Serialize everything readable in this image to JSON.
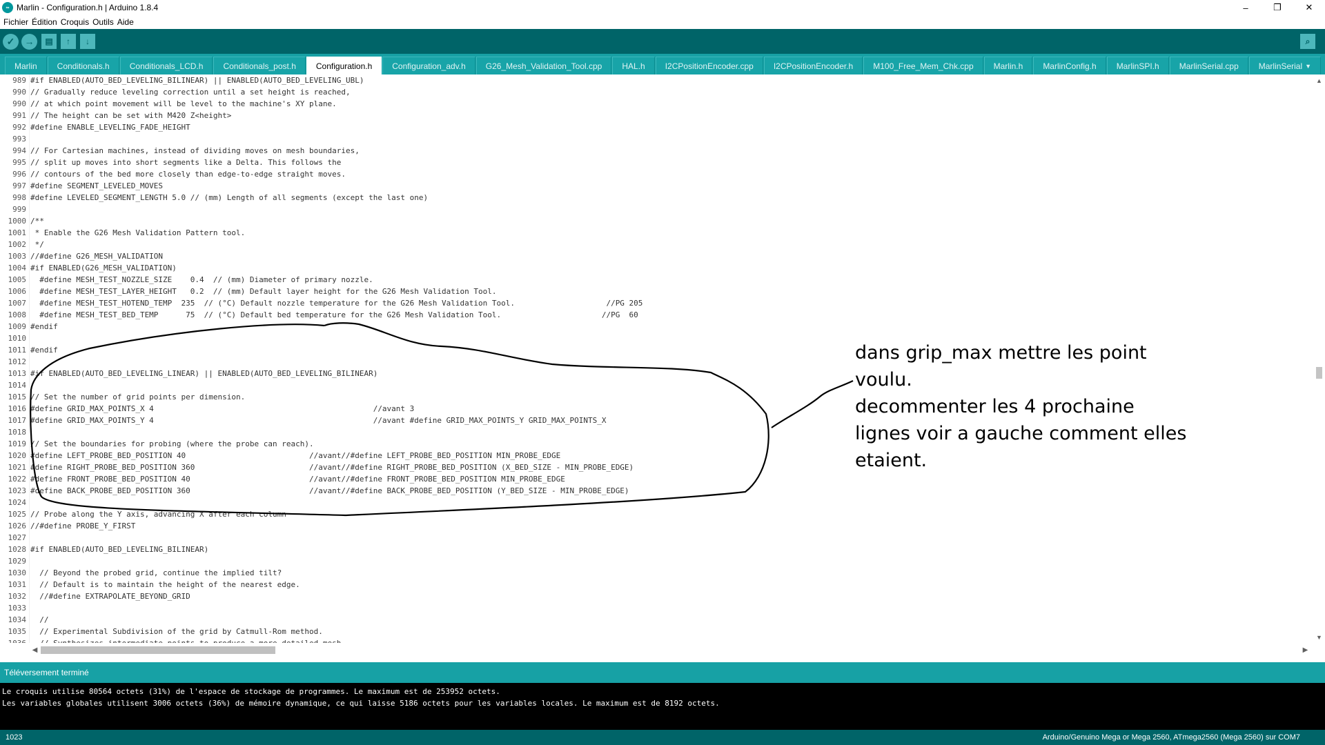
{
  "window": {
    "title": "Marlin - Configuration.h | Arduino 1.8.4",
    "app_icon_text": "∞",
    "controls": {
      "minimize": "–",
      "maximize": "❐",
      "close": "✕"
    }
  },
  "menu": [
    "Fichier",
    "Édition",
    "Croquis",
    "Outils",
    "Aide"
  ],
  "toolbar": {
    "verify_icon": "✓",
    "upload_icon": "→",
    "new_icon": "▤",
    "open_icon": "↑",
    "save_icon": "↓",
    "serial_monitor_icon": "⌕"
  },
  "tabs": [
    {
      "label": "Marlin"
    },
    {
      "label": "Conditionals.h"
    },
    {
      "label": "Conditionals_LCD.h"
    },
    {
      "label": "Conditionals_post.h"
    },
    {
      "label": "Configuration.h",
      "active": true
    },
    {
      "label": "Configuration_adv.h"
    },
    {
      "label": "G26_Mesh_Validation_Tool.cpp"
    },
    {
      "label": "HAL.h"
    },
    {
      "label": "I2CPositionEncoder.cpp"
    },
    {
      "label": "I2CPositionEncoder.h"
    },
    {
      "label": "M100_Free_Mem_Chk.cpp"
    },
    {
      "label": "Marlin.h"
    },
    {
      "label": "MarlinConfig.h"
    },
    {
      "label": "MarlinSPI.h"
    },
    {
      "label": "MarlinSerial.cpp"
    },
    {
      "label": "MarlinSerial",
      "dropdown": true
    }
  ],
  "code_lines": [
    {
      "n": "989",
      "t": "#if ENABLED(AUTO_BED_LEVELING_BILINEAR) || ENABLED(AUTO_BED_LEVELING_UBL)"
    },
    {
      "n": "990",
      "t": "// Gradually reduce leveling correction until a set height is reached,"
    },
    {
      "n": "990",
      "t": "// at which point movement will be level to the machine's XY plane."
    },
    {
      "n": "991",
      "t": "// The height can be set with M420 Z<height>"
    },
    {
      "n": "992",
      "t": "#define ENABLE_LEVELING_FADE_HEIGHT"
    },
    {
      "n": "993",
      "t": ""
    },
    {
      "n": "994",
      "t": "// For Cartesian machines, instead of dividing moves on mesh boundaries,"
    },
    {
      "n": "995",
      "t": "// split up moves into short segments like a Delta. This follows the"
    },
    {
      "n": "996",
      "t": "// contours of the bed more closely than edge-to-edge straight moves."
    },
    {
      "n": "997",
      "t": "#define SEGMENT_LEVELED_MOVES"
    },
    {
      "n": "998",
      "t": "#define LEVELED_SEGMENT_LENGTH 5.0 // (mm) Length of all segments (except the last one)"
    },
    {
      "n": "999",
      "t": ""
    },
    {
      "n": "1000",
      "t": "/**"
    },
    {
      "n": "1001",
      "t": " * Enable the G26 Mesh Validation Pattern tool."
    },
    {
      "n": "1002",
      "t": " */"
    },
    {
      "n": "1003",
      "t": "//#define G26_MESH_VALIDATION"
    },
    {
      "n": "1004",
      "t": "#if ENABLED(G26_MESH_VALIDATION)"
    },
    {
      "n": "1005",
      "t": "  #define MESH_TEST_NOZZLE_SIZE    0.4  // (mm) Diameter of primary nozzle."
    },
    {
      "n": "1006",
      "t": "  #define MESH_TEST_LAYER_HEIGHT   0.2  // (mm) Default layer height for the G26 Mesh Validation Tool."
    },
    {
      "n": "1007",
      "t": "  #define MESH_TEST_HOTEND_TEMP  235  // (°C) Default nozzle temperature for the G26 Mesh Validation Tool.                    //PG 205"
    },
    {
      "n": "1008",
      "t": "  #define MESH_TEST_BED_TEMP      75  // (°C) Default bed temperature for the G26 Mesh Validation Tool.                      //PG  60"
    },
    {
      "n": "1009",
      "t": "#endif"
    },
    {
      "n": "1010",
      "t": ""
    },
    {
      "n": "1011",
      "t": "#endif"
    },
    {
      "n": "1012",
      "t": ""
    },
    {
      "n": "1013",
      "t": "#if ENABLED(AUTO_BED_LEVELING_LINEAR) || ENABLED(AUTO_BED_LEVELING_BILINEAR)"
    },
    {
      "n": "1014",
      "t": ""
    },
    {
      "n": "1015",
      "t": "// Set the number of grid points per dimension."
    },
    {
      "n": "1016",
      "t": "#define GRID_MAX_POINTS_X 4                                                //avant 3"
    },
    {
      "n": "1017",
      "t": "#define GRID_MAX_POINTS_Y 4                                                //avant #define GRID_MAX_POINTS_Y GRID_MAX_POINTS_X"
    },
    {
      "n": "1018",
      "t": ""
    },
    {
      "n": "1019",
      "t": "// Set the boundaries for probing (where the probe can reach)."
    },
    {
      "n": "1020",
      "t": "#define LEFT_PROBE_BED_POSITION 40                           //avant//#define LEFT_PROBE_BED_POSITION MIN_PROBE_EDGE"
    },
    {
      "n": "1021",
      "t": "#define RIGHT_PROBE_BED_POSITION 360                         //avant//#define RIGHT_PROBE_BED_POSITION (X_BED_SIZE - MIN_PROBE_EDGE)"
    },
    {
      "n": "1022",
      "t": "#define FRONT_PROBE_BED_POSITION 40                          //avant//#define FRONT_PROBE_BED_POSITION MIN_PROBE_EDGE"
    },
    {
      "n": "1023",
      "t": "#define BACK_PROBE_BED_POSITION 360                          //avant//#define BACK_PROBE_BED_POSITION (Y_BED_SIZE - MIN_PROBE_EDGE)"
    },
    {
      "n": "1024",
      "t": ""
    },
    {
      "n": "1025",
      "t": "// Probe along the Y axis, advancing X after each column"
    },
    {
      "n": "1026",
      "t": "//#define PROBE_Y_FIRST"
    },
    {
      "n": "1027",
      "t": ""
    },
    {
      "n": "1028",
      "t": "#if ENABLED(AUTO_BED_LEVELING_BILINEAR)"
    },
    {
      "n": "1029",
      "t": ""
    },
    {
      "n": "1030",
      "t": "  // Beyond the probed grid, continue the implied tilt?"
    },
    {
      "n": "1031",
      "t": "  // Default is to maintain the height of the nearest edge."
    },
    {
      "n": "1032",
      "t": "  //#define EXTRAPOLATE_BEYOND_GRID"
    },
    {
      "n": "1033",
      "t": ""
    },
    {
      "n": "1034",
      "t": "  //"
    },
    {
      "n": "1035",
      "t": "  // Experimental Subdivision of the grid by Catmull-Rom method."
    },
    {
      "n": "1036",
      "t": "  // Synthesizes intermediate points to produce a more detailed mesh."
    }
  ],
  "scroll": {
    "up": "▲",
    "down": "▼",
    "left": "◀",
    "right": "▶"
  },
  "status": {
    "message": "Téléversement terminé"
  },
  "console": {
    "lines": [
      "Le croquis utilise 80564 octets (31%) de l'espace de stockage de programmes. Le maximum est de 253952 octets.",
      "Les variables globales utilisent 3006 octets (36%) de mémoire dynamique, ce qui laisse 5186 octets pour les variables locales. Le maximum est de 8192 octets."
    ]
  },
  "footer": {
    "line_number": "1023",
    "board": "Arduino/Genuino Mega or Mega 2560, ATmega2560 (Mega 2560) sur COM7"
  },
  "annotation": {
    "lines": [
      "dans grip_max mettre les point",
      "voulu.",
      "decommenter les 4 prochaine",
      "lignes voir a gauche comment elles",
      "etaient."
    ]
  }
}
